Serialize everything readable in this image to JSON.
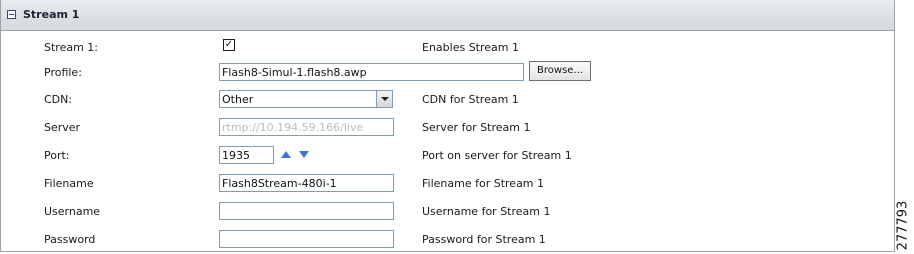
{
  "section": {
    "title": "Stream 1"
  },
  "rows": [
    {
      "label": "Stream 1:",
      "checked_mark": "✓",
      "desc": "Enables Stream 1"
    },
    {
      "label": "Profile:",
      "value": "Flash8-Simul-1.flash8.awp",
      "button": "Browse..."
    },
    {
      "label": "CDN:",
      "value": "Other",
      "desc": "CDN for Stream 1"
    },
    {
      "label": "Server",
      "value": "rtmp://10.194.59.166/live",
      "desc": "Server for Stream 1"
    },
    {
      "label": "Port:",
      "value": "1935",
      "desc": "Port on server for Stream 1"
    },
    {
      "label": "Filename",
      "value": "Flash8Stream-480i-1",
      "desc": "Filename for Stream 1"
    },
    {
      "label": "Username",
      "value": "",
      "desc": "Username for Stream 1"
    },
    {
      "label": "Password",
      "value": "",
      "desc": "Password for Stream 1"
    }
  ],
  "figure_id": "277793",
  "colors": {
    "accent_arrow": "#3d76d8",
    "field_border": "#7f9db9",
    "header_bg": "#d3d8dd"
  },
  "icons": {
    "collapse": "minus-box-icon",
    "spin_up": "arrow-up-icon",
    "spin_down": "arrow-down-icon",
    "dropdown": "chevron-down-icon"
  }
}
